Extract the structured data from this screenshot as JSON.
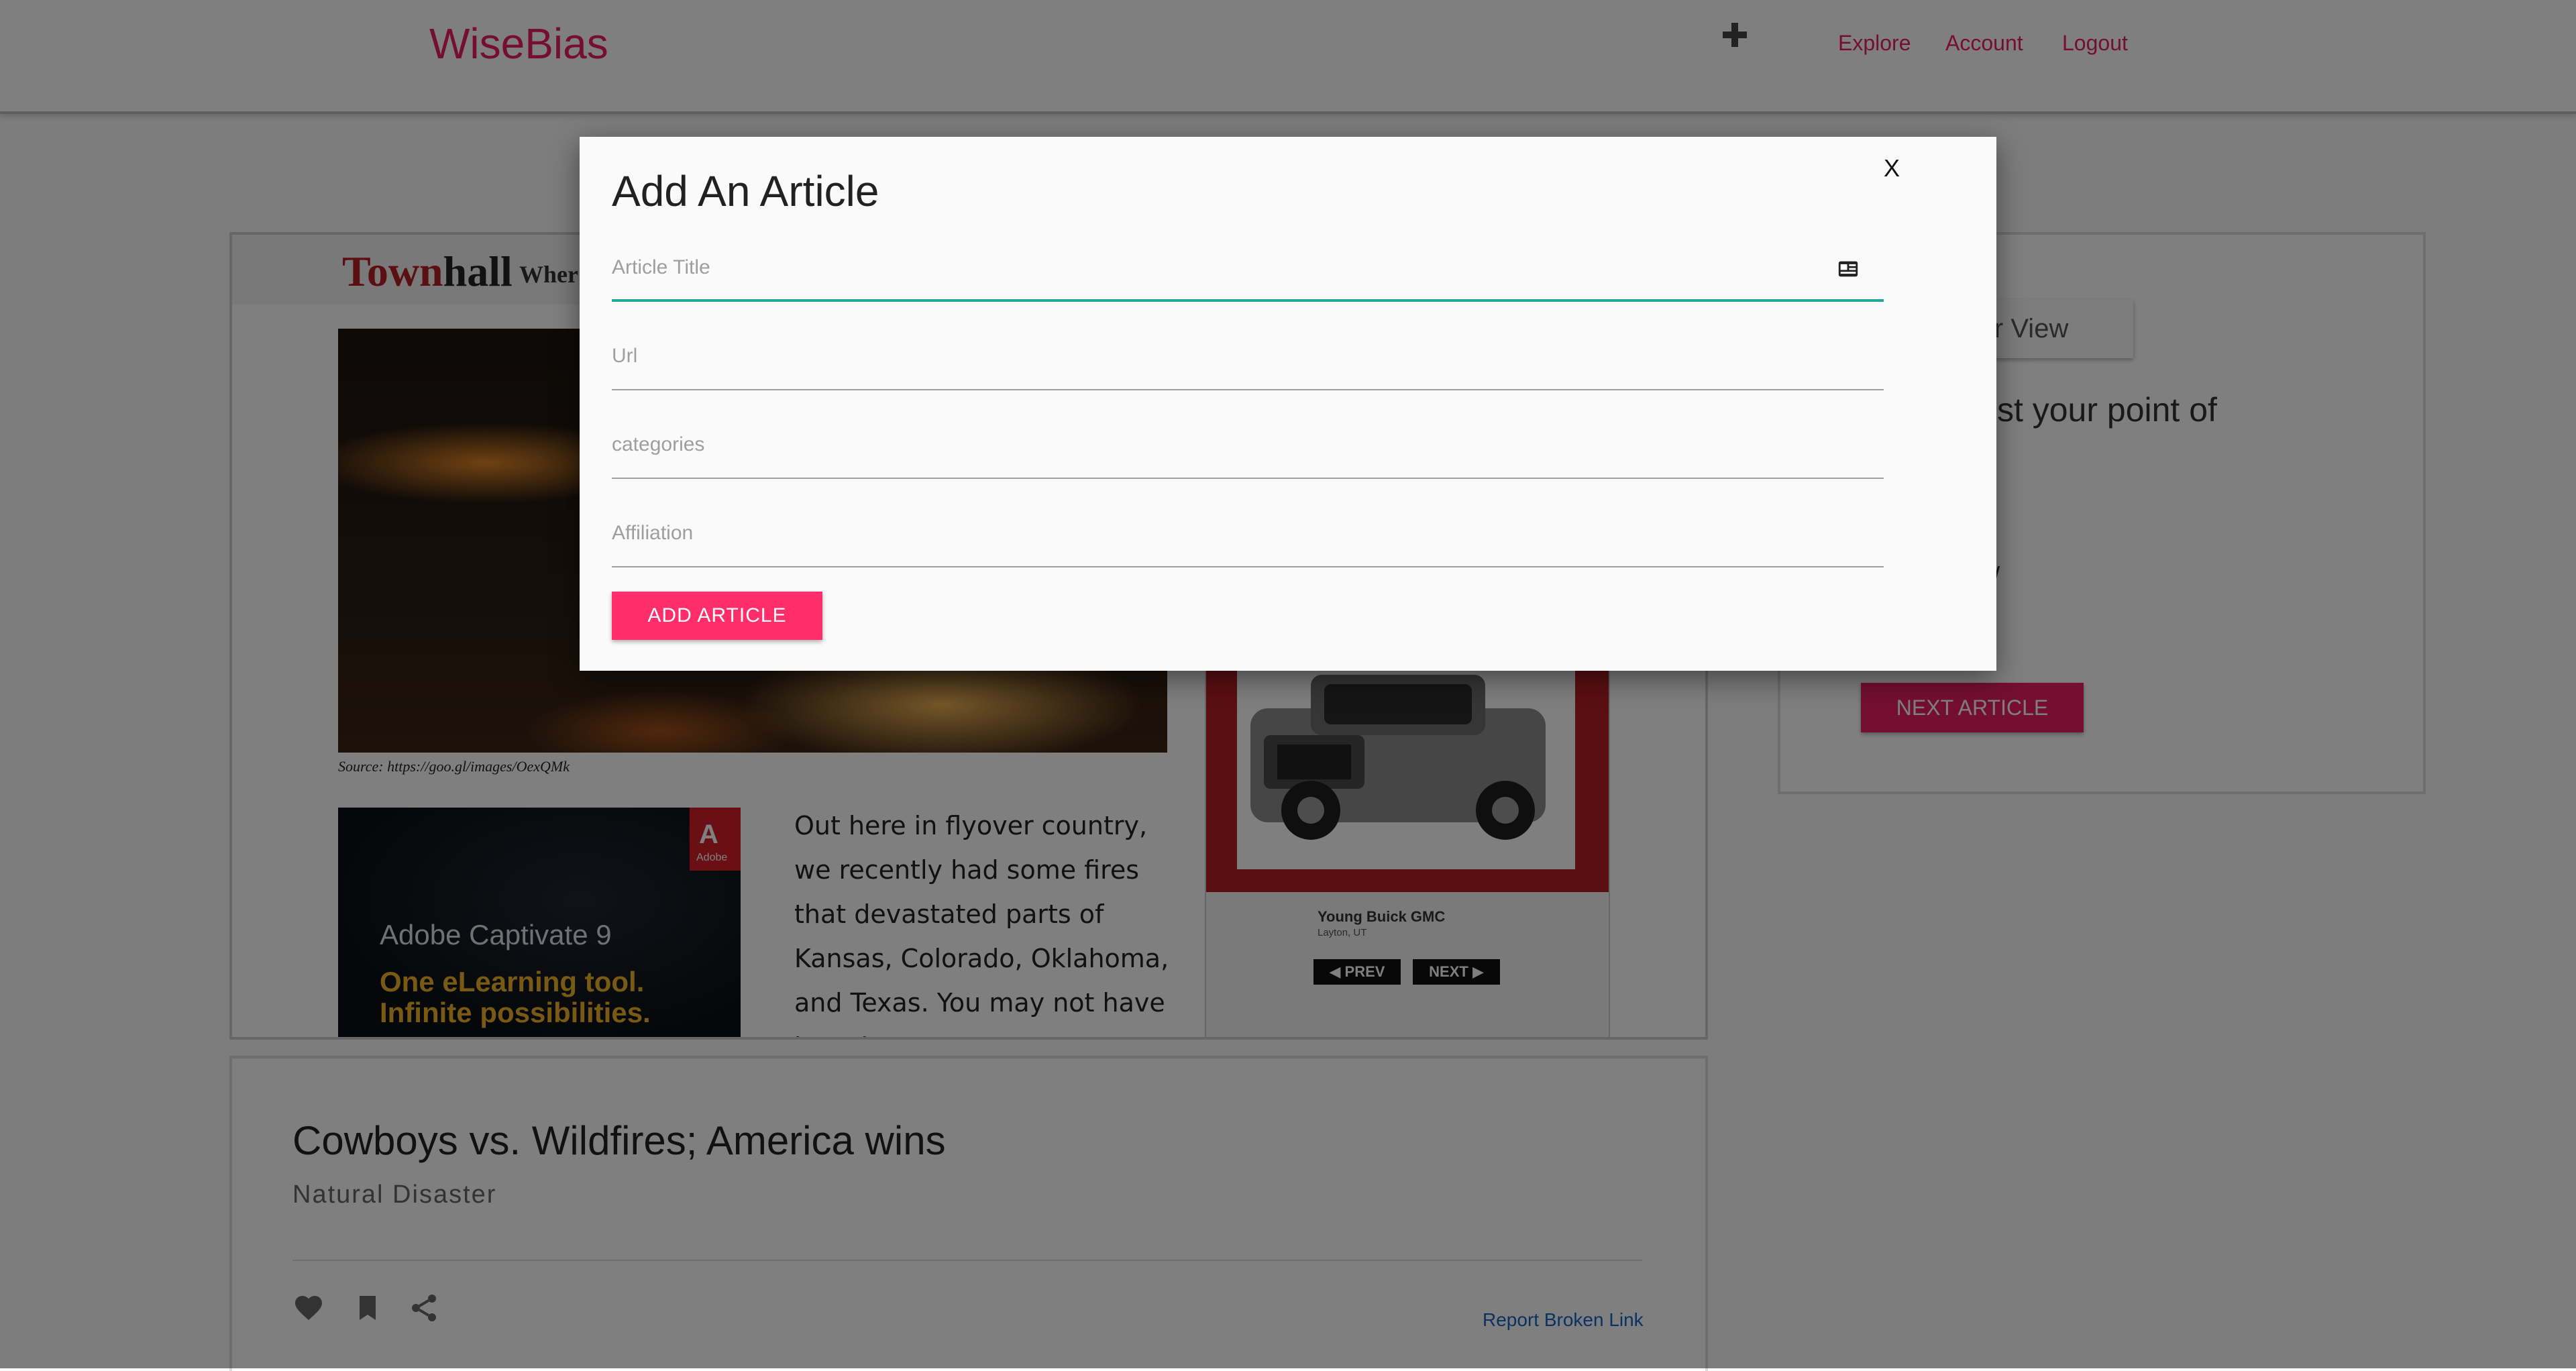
{
  "nav": {
    "brand": "WiseBias",
    "add_icon": "plus-icon",
    "links": [
      "Explore",
      "Account",
      "Logout"
    ]
  },
  "article_frame": {
    "site_logo_part1": "Town",
    "site_logo_part2": "hall",
    "site_tagline": "Wher",
    "photo_source": "Source: https://goo.gl/images/OexQMk",
    "body_text": "Out here in flyover country, we recently had some fires that devastated parts of Kansas, Colorado, Oklahoma, and Texas. You may not have heard",
    "ad_adobe": {
      "brand": "Adobe",
      "title": "Adobe Captivate 9",
      "line1": "One eLearning tool.",
      "line2": "Infinite possibilities."
    },
    "ad_car": {
      "dealer": "Young Buick GMC",
      "location": "Layton, UT",
      "prev": "PREV",
      "next": "NEXT"
    }
  },
  "side_panel": {
    "view_button_fragment": "er View",
    "question": "ideo adjust your point of\npolitics?",
    "mark_fragment": "/",
    "next_button": "NEXT ARTICLE"
  },
  "article_card": {
    "title": "Cowboys vs. Wildfires; America wins",
    "category": "Natural Disaster",
    "icons": [
      "heart-icon",
      "bookmark-icon",
      "share-icon"
    ],
    "report_link": "Report Broken Link"
  },
  "modal": {
    "title": "Add An Article",
    "close": "X",
    "fields": [
      {
        "placeholder": "Article Title",
        "active": true,
        "icon": "contact-card-icon"
      },
      {
        "placeholder": "Url"
      },
      {
        "placeholder": "categories"
      },
      {
        "placeholder": "Affiliation"
      }
    ],
    "submit": "ADD ARTICLE",
    "colors": {
      "accent": "#ff2d6a",
      "focus_line": "#26a69a"
    }
  },
  "colors": {
    "brand": "#e91e63",
    "link": "#1565c0"
  }
}
